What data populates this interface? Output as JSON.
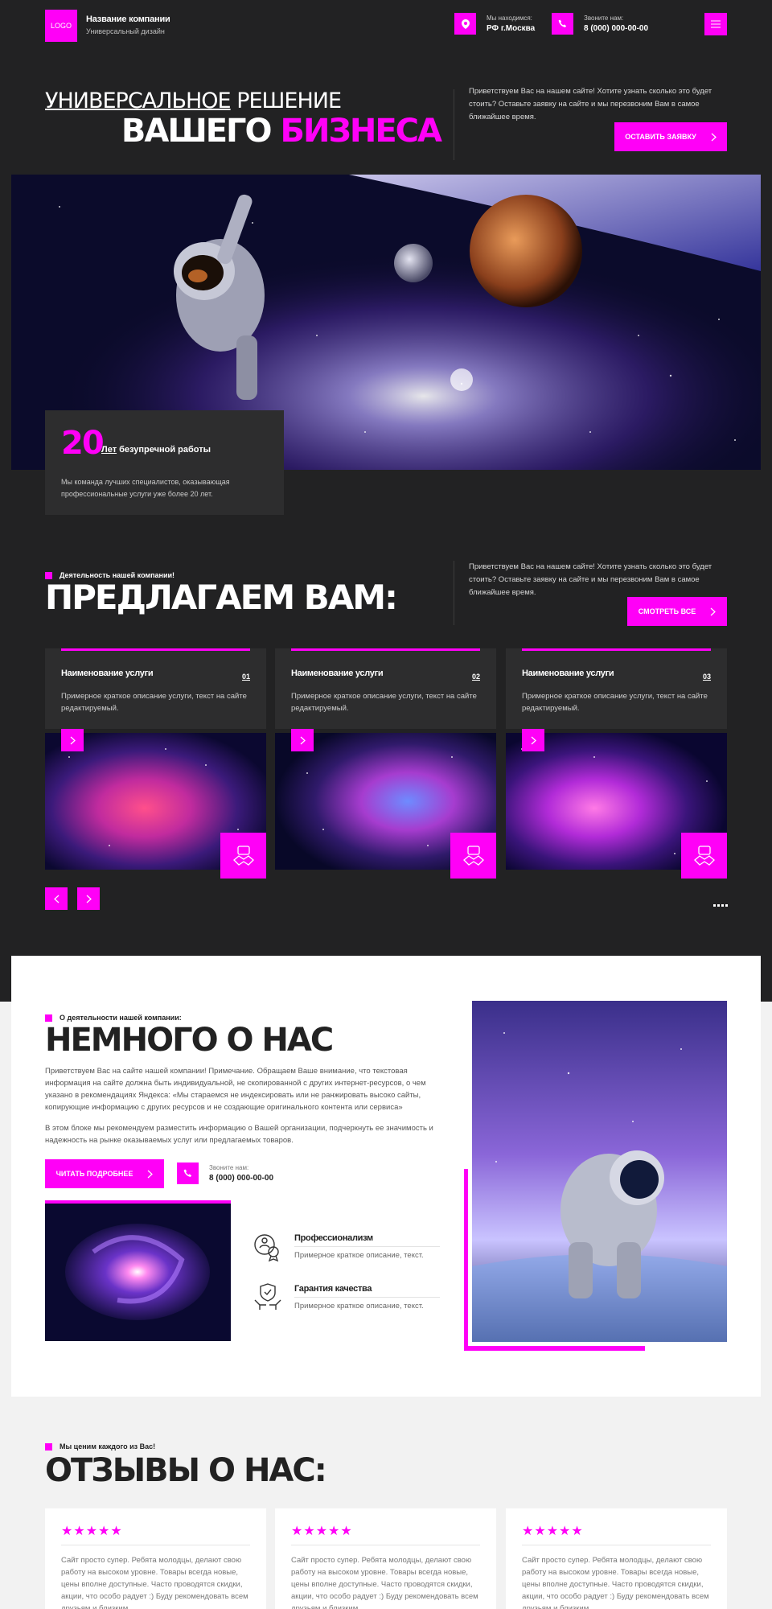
{
  "header": {
    "logo": "LOGO",
    "company": "Название компании",
    "tagline": "Универсальный дизайн",
    "location_label": "Мы находимся:",
    "location_value": "РФ г.Москва",
    "phone_label": "Звоните нам:",
    "phone_value": "8 (000) 000-00-00",
    "icons": [
      "location-pin-icon",
      "phone-icon",
      "menu-icon"
    ]
  },
  "hero": {
    "line1_underlined": "УНИВЕРСАЛЬНОЕ",
    "line1_rest": "РЕШЕНИЕ",
    "line2_white": "ВАШЕГО",
    "line2_accent": "БИЗНЕСА",
    "intro": "Приветствуем Вас на нашем сайте! Хотите узнать сколько это будет стоить? Оставьте заявку на сайте и мы перезвоним Вам в самое ближайшее время.",
    "cta": "ОСТАВИТЬ ЗАЯВКУ"
  },
  "stat": {
    "number": "20",
    "caption_underlined": "Лет",
    "caption_rest": "безупречной работы",
    "description": "Мы команда лучших специалистов, оказывающая профессиональные услуги уже более 20 лет."
  },
  "services": {
    "kicker": "Деятельность нашей компании!",
    "heading": "ПРЕДЛАГАЕМ ВАМ:",
    "intro": "Приветствуем Вас на нашем сайте! Хотите узнать сколько это будет стоить? Оставьте заявку на сайте и мы перезвоним Вам в самое ближайшее время.",
    "view_all": "СМОТРЕТЬ ВСЕ",
    "cards": [
      {
        "title": "Наименование услуги",
        "num": "01",
        "desc": "Примерное краткое описание услуги, текст на сайте редактируемый."
      },
      {
        "title": "Наименование услуги",
        "num": "02",
        "desc": "Примерное краткое описание услуги, текст на сайте редактируемый."
      },
      {
        "title": "Наименование услуги",
        "num": "03",
        "desc": "Примерное краткое описание услуги, текст на сайте редактируемый."
      }
    ]
  },
  "about": {
    "kicker": "О деятельности нашей компании:",
    "heading": "НЕМНОГО О НАС",
    "p1": "Приветствуем Вас на сайте нашей компании! Примечание. Обращаем Ваше внимание, что текстовая информация на сайте должна быть индивидуальной, не скопированной с других интернет-ресурсов, о чем указано в рекомендациях Яндекса: «Мы стараемся не индексировать или не ранжировать высоко сайты, копирующие информацию с других ресурсов и не создающие оригинального контента или сервиса»",
    "p2": "В этом блоке мы рекомендуем разместить информацию о Вашей организации, подчеркнуть ее значимость и надежность на рынке оказываемых услуг или предлагаемых товаров.",
    "read_more": "ЧИТАТЬ ПОДРОБНЕЕ",
    "phone_label": "Звоните нам:",
    "phone_value": "8 (000) 000-00-00",
    "features": [
      {
        "title": "Профессионализм",
        "desc": "Примерное краткое описание, текст."
      },
      {
        "title": "Гарантия качества",
        "desc": "Примерное краткое описание, текст."
      }
    ]
  },
  "reviews": {
    "kicker": "Мы ценим каждого из Вас!",
    "heading": "ОТЗЫВЫ О НАС:",
    "items": [
      {
        "stars": "★★★★★",
        "text": "Сайт просто супер. Ребята молодцы, делают свою работу на высоком уровне. Товары всегда новые, цены вполне доступные. Часто проводятся скидки, акции, что особо радует :) Буду рекомендовать всем друзьям и близким."
      },
      {
        "stars": "★★★★★",
        "text": "Сайт просто супер. Ребята молодцы, делают свою работу на высоком уровне. Товары всегда новые, цены вполне доступные. Часто проводятся скидки, акции, что особо радует :) Буду рекомендовать всем друзьям и близким."
      },
      {
        "stars": "★★★★★",
        "text": "Сайт просто супер. Ребята молодцы, делают свою работу на высоком уровне. Товары всегда новые, цены вполне доступные. Часто проводятся скидки, акции, что особо радует :) Буду рекомендовать всем друзьям и близким."
      }
    ]
  },
  "colors": {
    "accent": "#ff00f7",
    "dark_bg": "#222223",
    "card_bg": "#2d2d2e",
    "light_bg": "#f2f2f2"
  }
}
